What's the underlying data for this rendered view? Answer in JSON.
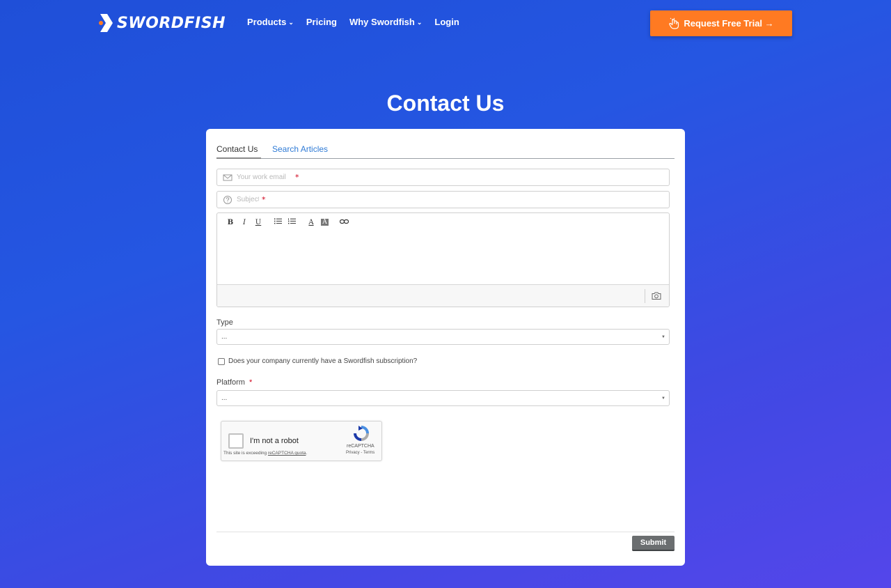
{
  "header": {
    "brand": "SWORDFISH",
    "nav": [
      {
        "label": "Products",
        "has_dropdown": true
      },
      {
        "label": "Pricing",
        "has_dropdown": false
      },
      {
        "label": "Why Swordfish",
        "has_dropdown": true
      },
      {
        "label": "Login",
        "has_dropdown": false
      }
    ],
    "cta_label": "Request Free Trial →"
  },
  "page": {
    "title": "Contact Us"
  },
  "form": {
    "tabs": [
      {
        "label": "Contact Us",
        "active": true
      },
      {
        "label": "Search Articles",
        "active": false
      }
    ],
    "email_placeholder": "Your work email",
    "subject_placeholder": "Subject",
    "required_mark": "*",
    "toolbar": {
      "bold": "B",
      "italic": "I",
      "underline": "U",
      "text_color": "A",
      "bg_color": "A"
    },
    "type_label": "Type",
    "type_value": "...",
    "subscription_label": "Does your company currently have a Swordfish subscription?",
    "platform_label": "Platform",
    "platform_value": "...",
    "recaptcha": {
      "label": "I'm not a robot",
      "brand": "reCAPTCHA",
      "links": "Privacy - Terms",
      "note_prefix": "This site is exceeding ",
      "note_link": "reCAPTCHA quota",
      "note_suffix": "."
    },
    "submit_label": "Submit"
  },
  "colors": {
    "cta": "#ff7a22",
    "tab_link": "#2f7bd6",
    "required": "#d0021b",
    "submit": "#6b6e70"
  }
}
